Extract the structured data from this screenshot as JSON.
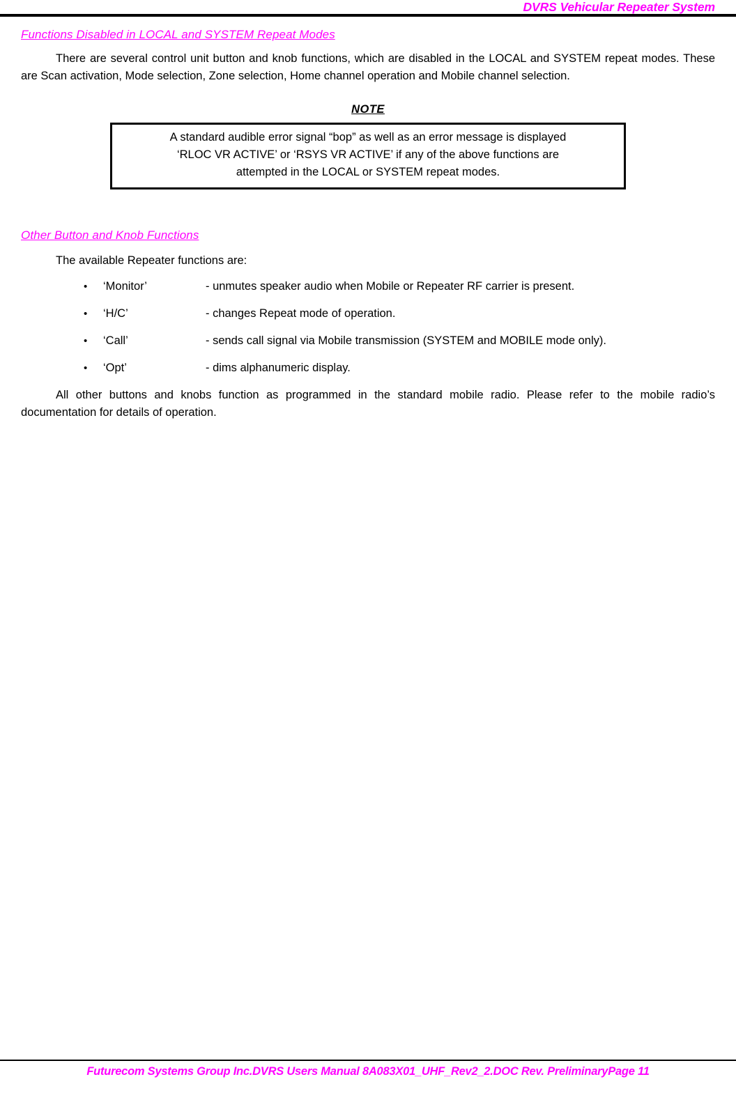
{
  "header": {
    "title": "DVRS Vehicular Repeater System"
  },
  "sections": [
    {
      "heading": "Functions Disabled in LOCAL and SYSTEM Repeat Modes",
      "paragraph": "There are several control unit button and knob functions, which are disabled in the LOCAL and SYSTEM repeat modes.  These are Scan activation, Mode selection, Zone selection, Home channel operation and Mobile channel selection."
    },
    {
      "heading": "Other Button and Knob Functions",
      "lead_in": "The available Repeater functions are:"
    }
  ],
  "note": {
    "label": "NOTE",
    "lines": [
      "A standard audible error signal “bop” as well as an error message is displayed",
      "‘RLOC VR ACTIVE’ or ‘RSYS VR ACTIVE’ if any of the above functions are",
      "attempted in the LOCAL or SYSTEM repeat modes."
    ]
  },
  "functions": {
    "bullet": "•",
    "items": [
      {
        "name": "‘Monitor’",
        "description": "- unmutes speaker audio when Mobile or Repeater RF carrier is present."
      },
      {
        "name": "‘H/C’",
        "description": "- changes Repeat mode of operation."
      },
      {
        "name": "‘Call’",
        "description": "- sends call signal via Mobile transmission (SYSTEM and MOBILE mode only)."
      },
      {
        "name": "‘Opt’",
        "description": "- dims alphanumeric display."
      }
    ]
  },
  "closing": {
    "paragraph": "All other buttons and knobs function as programmed in the standard mobile radio. Please refer to the mobile radio’s documentation for details of operation."
  },
  "footer": {
    "text": "Futurecom Systems Group Inc.DVRS Users Manual 8A083X01_UHF_Rev2_2.DOC Rev. PreliminaryPage 11"
  },
  "colors": {
    "accent": "#FF00FF",
    "text": "#000000",
    "background": "#FFFFFF"
  }
}
